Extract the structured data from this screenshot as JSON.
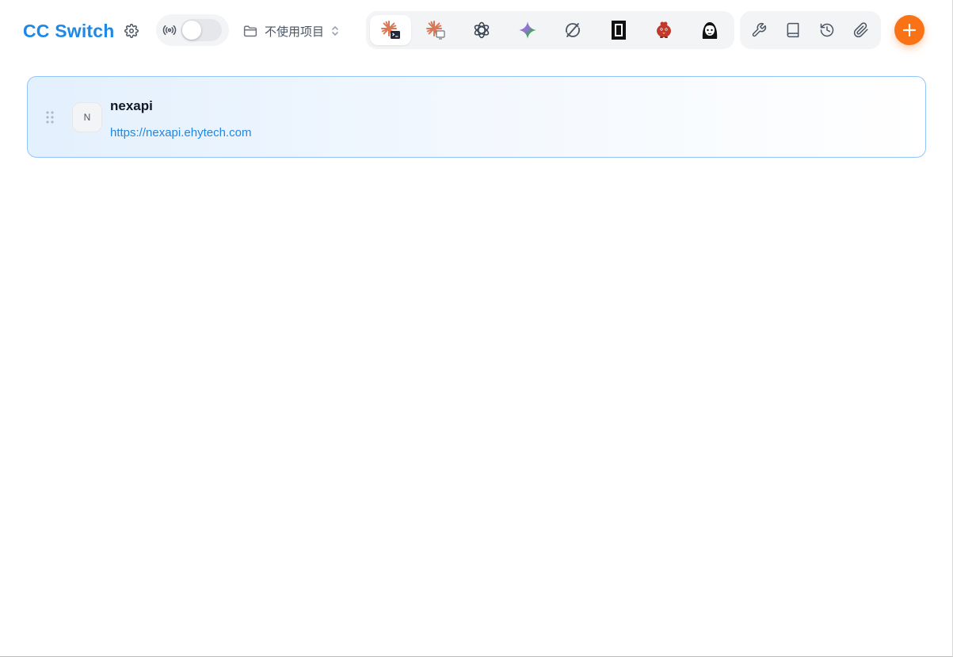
{
  "app": {
    "title": "CC Switch"
  },
  "header": {
    "proxy_toggle": {
      "enabled": false
    },
    "project_select": {
      "label": "不使用项目"
    },
    "apps": [
      {
        "name": "claude-code-terminal-icon",
        "active": true
      },
      {
        "name": "claude-desktop-icon",
        "active": false
      },
      {
        "name": "openai-icon",
        "active": false
      },
      {
        "name": "gemini-icon",
        "active": false
      },
      {
        "name": "refresh-orbit-icon",
        "active": false
      },
      {
        "name": "terminal-frame-icon",
        "active": false
      },
      {
        "name": "red-bird-icon",
        "active": false
      },
      {
        "name": "avatar-girl-icon",
        "active": false
      }
    ],
    "tools": [
      "wrench-icon",
      "book-icon",
      "history-icon",
      "paperclip-icon"
    ],
    "add_label": "+"
  },
  "providers": [
    {
      "initial": "N",
      "name": "nexapi",
      "url": "https://nexapi.ehytech.com",
      "selected": true
    }
  ],
  "colors": {
    "accent": "#1e88e5",
    "add_button": "#f97316",
    "card_border": "#93c5fd"
  }
}
